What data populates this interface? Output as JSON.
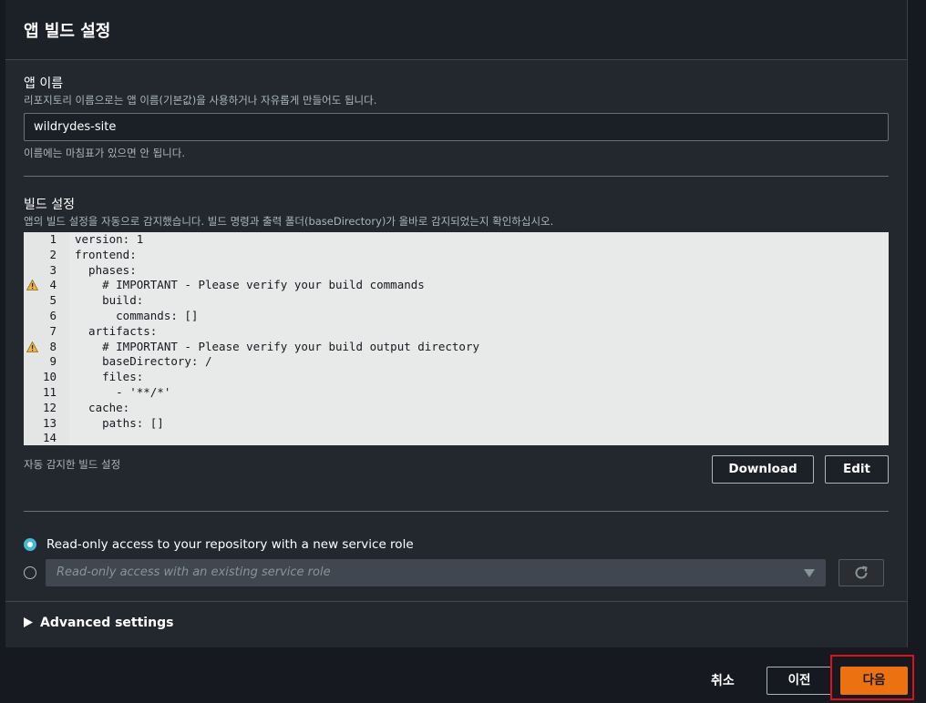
{
  "header": {
    "title": "앱 빌드 설정"
  },
  "app_name": {
    "label": "앱 이름",
    "description": "리포지토리 이름으로는 앱 이름(기본값)을 사용하거나 자유롭게 만들어도 됩니다.",
    "value": "wildrydes-site",
    "hint": "이름에는 마침표가 있으면 안 됩니다."
  },
  "build_settings": {
    "label": "빌드 설정",
    "description": "앱의 빌드 설정을 자동으로 감지했습니다. 빌드 명령과 출력 폴더(baseDirectory)가 올바로 감지되었는지 확인하십시오.",
    "caption": "자동 감지한 빌드 설정",
    "download_label": "Download",
    "edit_label": "Edit",
    "code_lines": [
      {
        "n": "1",
        "text": "version: 1",
        "warn": false
      },
      {
        "n": "2",
        "text": "frontend:",
        "warn": false
      },
      {
        "n": "3",
        "text": "  phases:",
        "warn": false
      },
      {
        "n": "4",
        "text": "    # IMPORTANT - Please verify your build commands",
        "warn": true
      },
      {
        "n": "5",
        "text": "    build:",
        "warn": false
      },
      {
        "n": "6",
        "text": "      commands: []",
        "warn": false
      },
      {
        "n": "7",
        "text": "  artifacts:",
        "warn": false
      },
      {
        "n": "8",
        "text": "    # IMPORTANT - Please verify your build output directory",
        "warn": true
      },
      {
        "n": "9",
        "text": "    baseDirectory: /",
        "warn": false
      },
      {
        "n": "10",
        "text": "    files:",
        "warn": false
      },
      {
        "n": "11",
        "text": "      - '**/*'",
        "warn": false
      },
      {
        "n": "12",
        "text": "  cache:",
        "warn": false
      },
      {
        "n": "13",
        "text": "    paths: []",
        "warn": false
      },
      {
        "n": "14",
        "text": "",
        "warn": false
      }
    ]
  },
  "service_role": {
    "option_new": "Read-only access to your repository with a new service role",
    "option_existing_placeholder": "Read-only access with an existing service role",
    "selected": "new"
  },
  "advanced": {
    "label": "Advanced settings"
  },
  "footer": {
    "cancel_label": "취소",
    "previous_label": "이전",
    "next_label": "다음"
  },
  "colors": {
    "accent": "#44b9d6",
    "primary_button": "#ec7211",
    "highlight_box": "#e0101a",
    "warning": "#f2b43b"
  }
}
